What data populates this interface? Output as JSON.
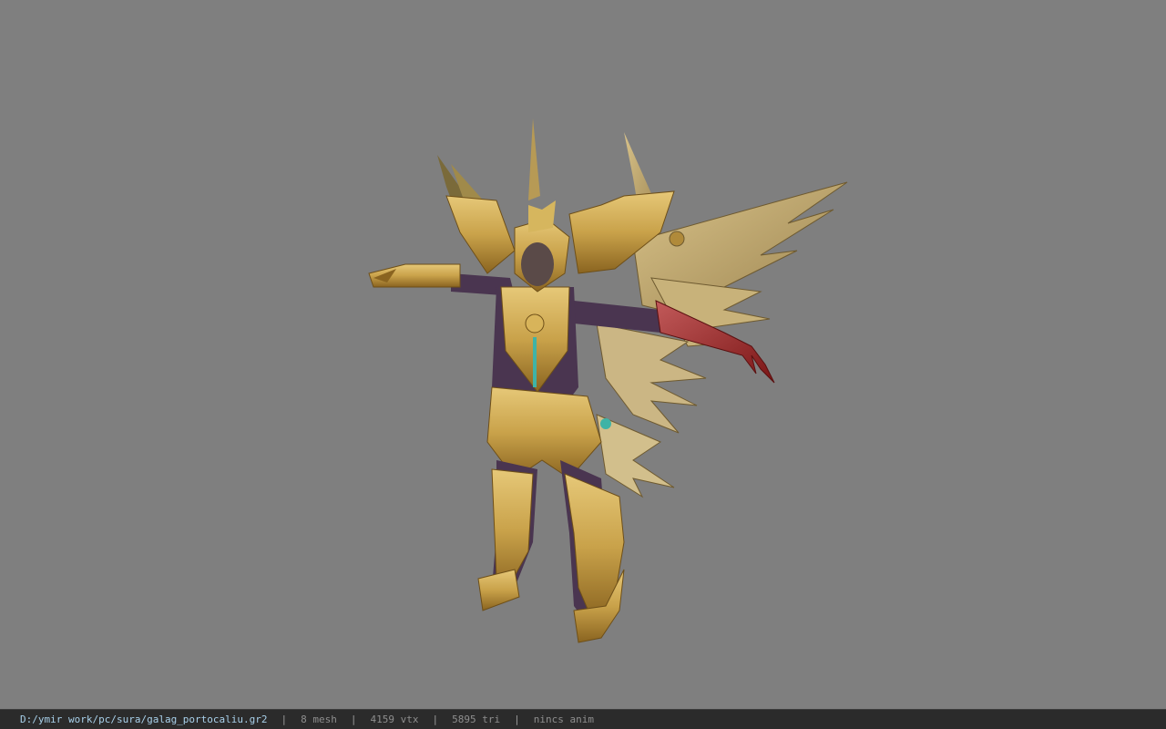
{
  "viewer": {
    "background_color": "#7f7f7f",
    "model_icon": "winged-golden-armor-character-model"
  },
  "statusbar": {
    "file_path": "D:/ymir work/pc/sura/galag_portocaliu.gr2",
    "separator": "|",
    "mesh": "8 mesh",
    "vertices": "4159 vtx",
    "triangles": "5895 tri",
    "animation": "nincs anim"
  },
  "colors": {
    "statusbar_bg": "#2b2b2b",
    "path_text": "#a8d0ea",
    "info_text": "#9a9a9a",
    "gold": "#c9a24a",
    "dark_gold": "#8a6420",
    "purple": "#4a3550",
    "claw_red": "#9b2b2b"
  }
}
